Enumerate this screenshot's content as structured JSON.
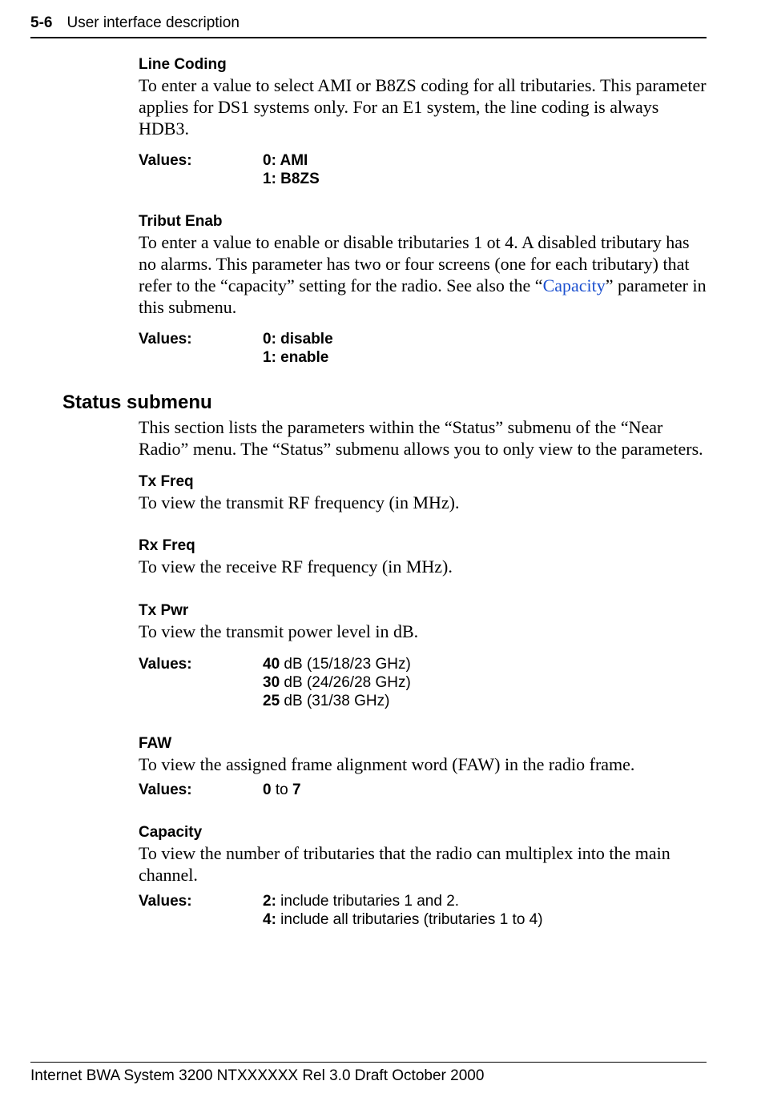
{
  "header": {
    "page_number": "5-6",
    "section_title": "User interface description"
  },
  "sections": {
    "line_coding": {
      "heading": "Line Coding",
      "text": "To enter a value to select AMI or B8ZS coding for all tributaries. This parameter applies for DS1 systems only. For an E1 system, the line coding is always HDB3.",
      "values_label": "Values:",
      "values": [
        {
          "bold": "0: AMI",
          "rest": ""
        },
        {
          "bold": "1: B8ZS",
          "rest": ""
        }
      ]
    },
    "tribut_enab": {
      "heading": "Tribut Enab",
      "pre_text": "To enter a value to enable or disable tributaries 1 ot 4. A disabled tributary has no alarms. This parameter has two or four screens (one for each tributary) that refer to the “capacity” setting for the radio. See also the “",
      "link_text": "Capacity",
      "post_text": "” parameter in this submenu.",
      "values_label": "Values:",
      "values": [
        {
          "bold": "0: disable",
          "rest": ""
        },
        {
          "bold": "1: enable",
          "rest": ""
        }
      ]
    },
    "status_submenu": {
      "heading": "Status submenu",
      "text": "This section lists the parameters within the “Status” submenu of the “Near Radio” menu. The “Status” submenu allows you to only view to the parameters."
    },
    "tx_freq": {
      "heading": "Tx Freq",
      "text": "To view the transmit RF frequency (in MHz)."
    },
    "rx_freq": {
      "heading": "Rx Freq",
      "text": "To view the receive RF frequency (in MHz)."
    },
    "tx_pwr": {
      "heading": "Tx Pwr",
      "text": "To view the transmit power level in dB.",
      "values_label": "Values:",
      "values": [
        {
          "bold": "40",
          "rest": " dB (15/18/23 GHz)"
        },
        {
          "bold": "30",
          "rest": " dB (24/26/28 GHz)"
        },
        {
          "bold": "25",
          "rest": " dB (31/38 GHz)"
        }
      ]
    },
    "faw": {
      "heading": "FAW",
      "text": "To view the assigned frame alignment word (FAW) in the radio frame.",
      "values_label": "Values:",
      "value_prefix": "0",
      "value_mid": " to ",
      "value_suffix": "7"
    },
    "capacity": {
      "heading": "Capacity",
      "text": "To view the number of tributaries that the radio can multiplex into the main channel.",
      "values_label": "Values:",
      "values": [
        {
          "bold": "2:",
          "rest": " include tributaries 1 and 2."
        },
        {
          "bold": "4:",
          "rest": " include all tributaries (tributaries 1 to 4)"
        }
      ]
    }
  },
  "footer": {
    "text": "Internet BWA System 3200     NTXXXXXX   Rel 3.0   Draft October 2000"
  }
}
